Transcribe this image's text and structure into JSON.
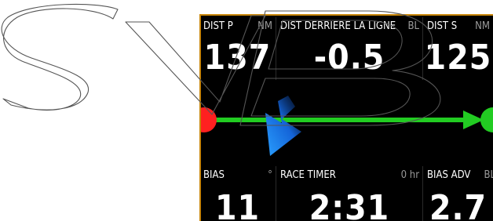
{
  "watermark_text": "SVB",
  "colors": {
    "background": "#000000",
    "frame": "#c8860a",
    "label": "#ffffff",
    "unit": "#9a9a9a",
    "value": "#ffffff",
    "start_line": "#22cc22",
    "port_end": "#ff2020",
    "stbd_end": "#22cc22",
    "wind_arrow": "#1e90ff"
  },
  "tiles_top": [
    {
      "label": "DIST P",
      "unit": "NM",
      "value": "137"
    },
    {
      "label": "DIST DERRIERE LA LIGNE",
      "unit": "BL",
      "value": "-0.5"
    },
    {
      "label": "DIST S",
      "unit": "NM",
      "value": "125"
    }
  ],
  "tiles_bottom": [
    {
      "label": "BIAS",
      "unit": "°",
      "value": "11"
    },
    {
      "label": "RACE TIMER",
      "unit": "0 hr",
      "value": "2:31"
    },
    {
      "label": "BIAS ADV",
      "unit": "BL",
      "value": "2.7"
    }
  ],
  "icons": {
    "port_marker": "red-circle",
    "stbd_marker": "green-circle",
    "line_arrow": "arrow-right",
    "wind_arrow": "arrow-down-left"
  }
}
